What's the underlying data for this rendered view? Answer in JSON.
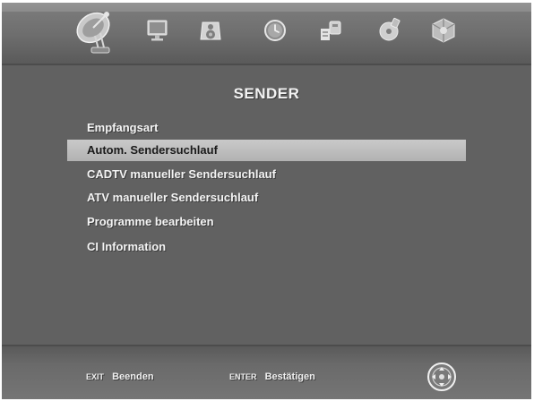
{
  "header": {
    "tabs": [
      {
        "icon": "satellite-dish-icon",
        "active": true
      },
      {
        "icon": "monitor-icon",
        "active": false
      },
      {
        "icon": "speaker-icon",
        "active": false
      },
      {
        "icon": "clock-icon",
        "active": false
      },
      {
        "icon": "lock-icon",
        "active": false
      },
      {
        "icon": "usb-disk-icon",
        "active": false
      },
      {
        "icon": "settings-cube-icon",
        "active": false
      }
    ]
  },
  "menu": {
    "title": "SENDER",
    "items": [
      {
        "label": "Empfangsart",
        "selected": false
      },
      {
        "label": "Autom. Sendersuchlauf",
        "selected": true
      },
      {
        "label": "CADTV manueller Sendersuchlauf",
        "selected": false
      },
      {
        "label": "ATV manueller Sendersuchlauf",
        "selected": false
      },
      {
        "label": "Programme bearbeiten",
        "selected": false
      },
      {
        "label": "CI Information",
        "selected": false
      }
    ]
  },
  "footer": {
    "exit_key": "EXIT",
    "exit_label": "Beenden",
    "enter_key": "ENTER",
    "enter_label": "Bestätigen",
    "nav_icon": "navigation-pad-icon"
  },
  "colors": {
    "background": "#616161",
    "text": "#f4f4f4",
    "highlight": "#bdbdbd",
    "highlight_text": "#1a1a1a"
  }
}
